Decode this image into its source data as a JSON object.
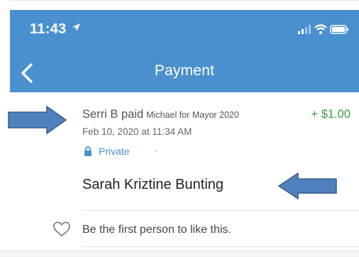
{
  "status_bar": {
    "time": "11:43",
    "location_icon": "location-arrow-icon",
    "icons": [
      "signal-bars-icon",
      "wifi-icon",
      "battery-icon"
    ]
  },
  "nav": {
    "back_icon": "chevron-left-icon",
    "title": "Payment"
  },
  "transaction": {
    "payer": "Serri B paid",
    "recipient": "Michael for Mayor 2020",
    "amount": "+ $1.00",
    "timestamp": "Feb 10, 2020 at 11:34 AM",
    "privacy_icon": "lock-icon",
    "privacy_label": "Private",
    "note": "Sarah Kriztine Bunting"
  },
  "likes": {
    "heart_icon": "heart-outline-icon",
    "prompt": "Be the first person to like this."
  },
  "annotations": {
    "arrow_icon_1": "arrow-right-icon",
    "arrow_icon_2": "arrow-left-icon"
  },
  "colors": {
    "header": "#4a90cf",
    "amount": "#3f9a43",
    "link": "#4a90cf",
    "annotation_arrow": "#4f81bd"
  }
}
